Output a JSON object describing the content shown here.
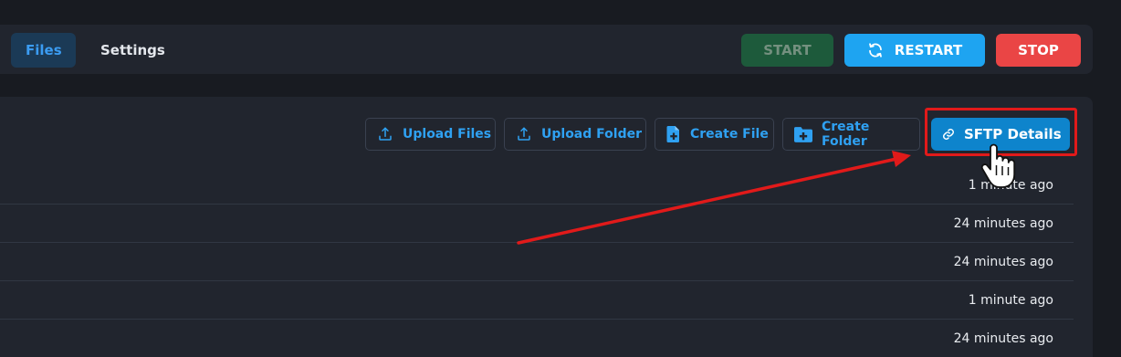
{
  "tabs": [
    {
      "label": "Files",
      "active": true
    },
    {
      "label": "Settings",
      "active": false
    }
  ],
  "power": {
    "start_label": "START",
    "restart_label": "RESTART",
    "stop_label": "STOP"
  },
  "file_actions": {
    "upload_files": "Upload Files",
    "upload_folder": "Upload Folder",
    "create_file": "Create File",
    "create_folder": "Create Folder",
    "sftp_details": "SFTP Details"
  },
  "file_rows": [
    {
      "modified": "1 minute ago"
    },
    {
      "modified": "24 minutes ago"
    },
    {
      "modified": "24 minutes ago"
    },
    {
      "modified": "1 minute ago"
    },
    {
      "modified": "24 minutes ago"
    }
  ],
  "colors": {
    "accent_blue": "#1ea4f1",
    "start_green": "#1d5a3b",
    "stop_red": "#ea4545",
    "annotation_red": "#e11a1a"
  },
  "icons": {
    "restart": "refresh-icon",
    "upload_files": "upload-icon",
    "upload_folder": "upload-icon",
    "create_file": "file-plus-icon",
    "create_folder": "folder-plus-icon",
    "sftp": "link-icon",
    "cursor": "hand-pointer-icon"
  }
}
